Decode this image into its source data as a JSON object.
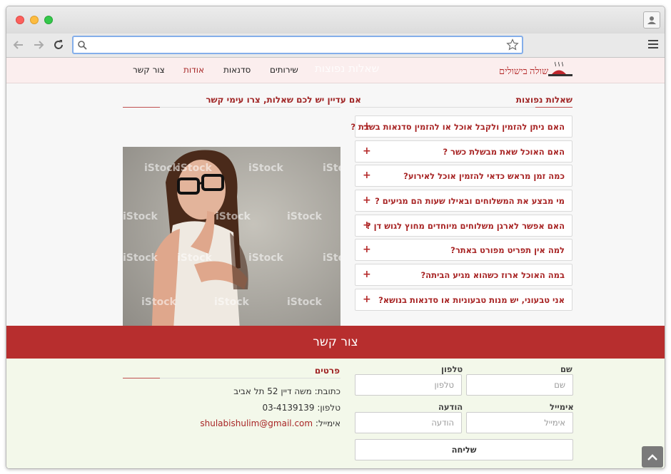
{
  "browser": {
    "url": ""
  },
  "header": {
    "logo_text": "שולה בישולים",
    "faded_title": "שאלות נפוצות",
    "nav": [
      {
        "label": "צור קשר"
      },
      {
        "label": "אודות"
      },
      {
        "label": "סדנאות"
      },
      {
        "label": "שירותים"
      }
    ]
  },
  "faq": {
    "title": "שאלות נפוצות",
    "items": [
      {
        "question": "האם ניתן להזמין ולקבל אוכל או להזמין סדנאות בשבת ?"
      },
      {
        "question": "האם האוכל שאת מבשלת כשר ?"
      },
      {
        "question": "כמה זמן מראש כדאי להזמין אוכל לאירוע?"
      },
      {
        "question": "מי מבצע את המשלוחים ובאילו שעות הם מגיעים ?"
      },
      {
        "question": "האם אפשר לארגן משלוחים מיוחדים מחוץ לגוש דן ?"
      },
      {
        "question": "למה אין תפריט מפורט באתר?"
      },
      {
        "question": "במה האוכל ארוז כשהוא מגיע הביתה?"
      },
      {
        "question": "אני טבעוני, יש מנות טבעוניות או סדנאות בנושא?"
      }
    ]
  },
  "questions_box": {
    "title": "אם עדיין יש לכם שאלות, צרו עימי קשר",
    "watermark": "iStock"
  },
  "contact": {
    "banner": "צור קשר",
    "name_label": "שם",
    "name_placeholder": "שם",
    "phone_label": "טלפון",
    "phone_placeholder": "טלפון",
    "email_label": "אימייל",
    "email_placeholder": "אימייל",
    "message_label": "הודעה",
    "message_placeholder": "הודעה",
    "send_label": "שליחה",
    "details_title": "פרטים",
    "address": "כתובת: משה דיין 52 תל אביב",
    "phone_line": "טלפון: 03-4139139",
    "email_prefix": "אימייל:",
    "email_value": "shulabishulim@gmail.com"
  }
}
